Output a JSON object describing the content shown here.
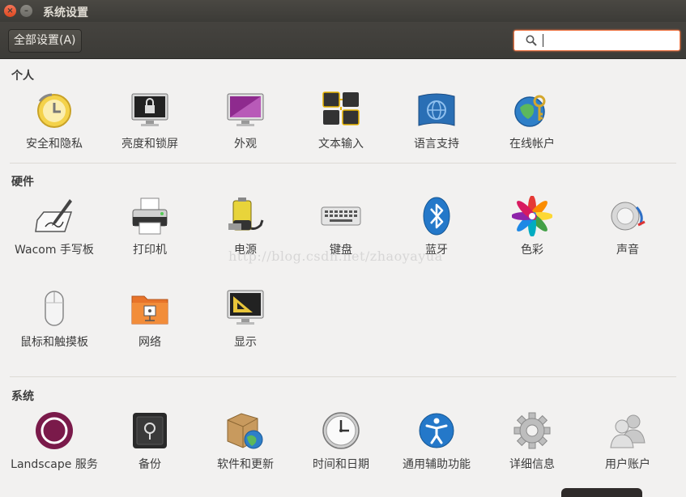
{
  "window": {
    "title": "系统设置"
  },
  "toolbar": {
    "all_settings_label": "全部设置(A)",
    "search_value": ""
  },
  "sections": {
    "personal": {
      "title": "个人",
      "items": [
        "安全和隐私",
        "亮度和锁屏",
        "外观",
        "文本输入",
        "语言支持",
        "在线帐户"
      ]
    },
    "hardware": {
      "title": "硬件",
      "items": [
        "Wacom 手写板",
        "打印机",
        "电源",
        "键盘",
        "蓝牙",
        "色彩",
        "声音",
        "鼠标和触摸板",
        "网络",
        "显示"
      ]
    },
    "system": {
      "title": "系统",
      "items": [
        "Landscape 服务",
        "备份",
        "软件和更新",
        "时间和日期",
        "通用辅助功能",
        "详细信息",
        "用户账户"
      ]
    }
  },
  "watermark": "http://blog.csdn.net/zhaoyayua",
  "colors": {
    "accent": "#f07746",
    "titlebar": "#3c3b37",
    "background": "#f2f1f0"
  }
}
